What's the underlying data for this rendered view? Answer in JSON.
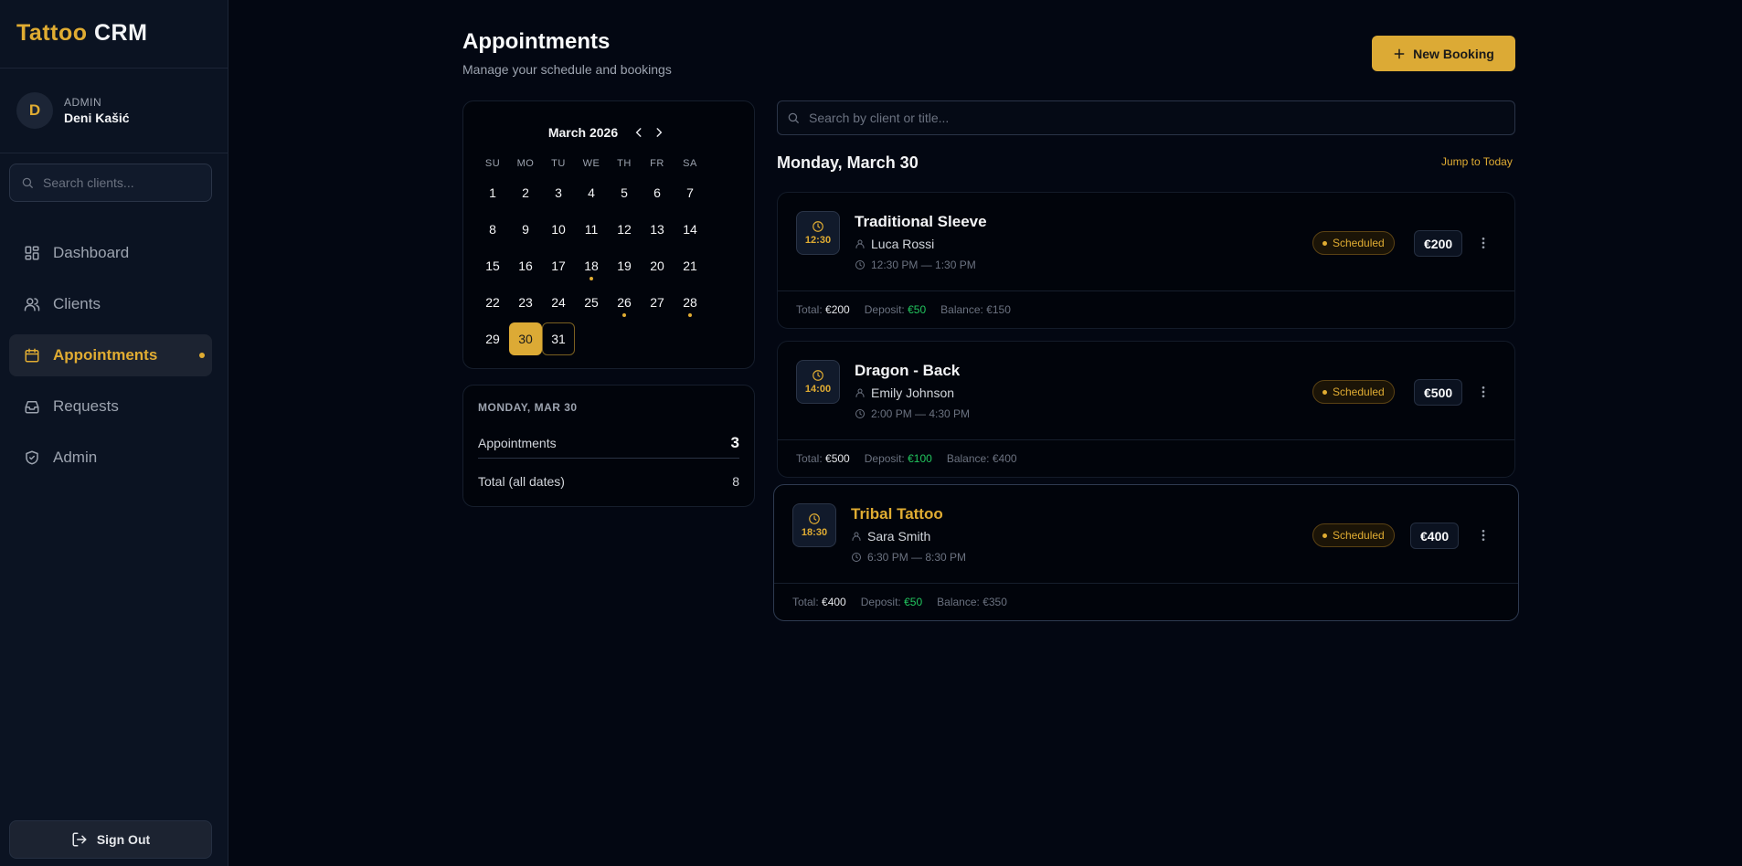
{
  "brand": {
    "accent": "Tattoo",
    "rest": "CRM"
  },
  "user": {
    "initial": "D",
    "role": "ADMIN",
    "name": "Deni Kašić"
  },
  "sidebar": {
    "search_placeholder": "Search clients...",
    "items": [
      {
        "label": "Dashboard",
        "icon": "dashboard-icon"
      },
      {
        "label": "Clients",
        "icon": "users-icon"
      },
      {
        "label": "Appointments",
        "icon": "calendar-icon",
        "active": true
      },
      {
        "label": "Requests",
        "icon": "inbox-icon"
      },
      {
        "label": "Admin",
        "icon": "shield-icon"
      }
    ],
    "sign_out": "Sign Out"
  },
  "header": {
    "title": "Appointments",
    "subtitle": "Manage your schedule and bookings",
    "new_booking": "New Booking"
  },
  "calendar": {
    "month": "March 2026",
    "dows": [
      "SU",
      "MO",
      "TU",
      "WE",
      "TH",
      "FR",
      "SA"
    ],
    "weeks": [
      [
        "1",
        "2",
        "3",
        "4",
        "5",
        "6",
        "7"
      ],
      [
        "8",
        "9",
        "10",
        "11",
        "12",
        "13",
        "14"
      ],
      [
        "15",
        "16",
        "17",
        "18",
        "19",
        "20",
        "21"
      ],
      [
        "22",
        "23",
        "24",
        "25",
        "26",
        "27",
        "28"
      ],
      [
        "29",
        "30",
        "31"
      ]
    ],
    "dot_days": [
      "18",
      "26",
      "28"
    ],
    "selected": "30",
    "today": "31"
  },
  "summary": {
    "date_label": "MONDAY, MAR 30",
    "appointments_label": "Appointments",
    "appointments_count": "3",
    "total_label": "Total (all dates)",
    "total_count": "8"
  },
  "list": {
    "search_placeholder": "Search by client or title...",
    "day_title": "Monday, March 30",
    "jump_today": "Jump to Today"
  },
  "appointments": [
    {
      "time": "12:30",
      "title": "Traditional Sleeve",
      "client": "Luca Rossi",
      "range": "12:30 PM — 1:30 PM",
      "status": "Scheduled",
      "price": "€200",
      "total_label": "Total:",
      "total": "€200",
      "deposit_label": "Deposit:",
      "deposit": "€50",
      "balance_label": "Balance:",
      "balance": "€150"
    },
    {
      "time": "14:00",
      "title": "Dragon - Back",
      "client": "Emily Johnson",
      "range": "2:00 PM — 4:30 PM",
      "status": "Scheduled",
      "price": "€500",
      "total_label": "Total:",
      "total": "€500",
      "deposit_label": "Deposit:",
      "deposit": "€100",
      "balance_label": "Balance:",
      "balance": "€400"
    },
    {
      "time": "18:30",
      "title": "Tribal Tattoo",
      "client": "Sara Smith",
      "range": "6:30 PM — 8:30 PM",
      "status": "Scheduled",
      "price": "€400",
      "total_label": "Total:",
      "total": "€400",
      "deposit_label": "Deposit:",
      "deposit": "€50",
      "balance_label": "Balance:",
      "balance": "€350"
    }
  ],
  "colors": {
    "accent": "#e0ac32",
    "background": "#030712",
    "sidebar": "#0b1322",
    "deposit_green": "#22c55e"
  }
}
